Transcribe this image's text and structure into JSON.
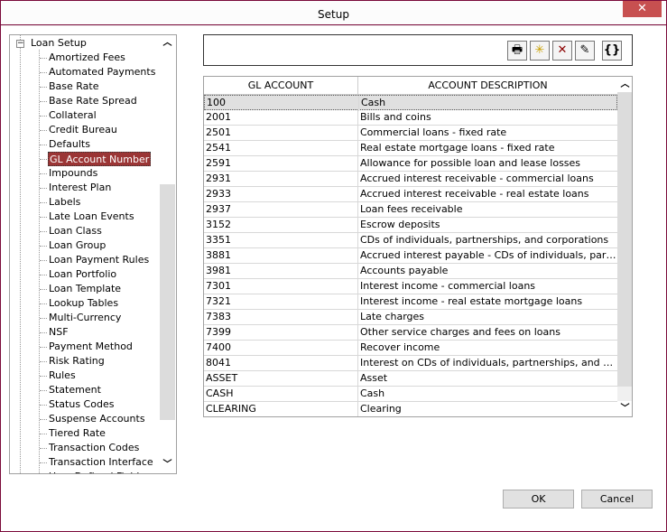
{
  "window": {
    "title": "Setup",
    "close_icon": "close-icon",
    "border_color": "#7a0a3a",
    "selected_color": "#9b3535"
  },
  "tree": {
    "root": "Loan Setup",
    "selected": "GL Account Number",
    "items": [
      "Amortized Fees",
      "Automated Payments",
      "Base Rate",
      "Base Rate Spread",
      "Collateral",
      "Credit Bureau",
      "Defaults",
      "GL Account Number",
      "Impounds",
      "Interest Plan",
      "Labels",
      "Late Loan Events",
      "Loan Class",
      "Loan Group",
      "Loan Payment Rules",
      "Loan Portfolio",
      "Loan Template",
      "Lookup Tables",
      "Multi-Currency",
      "NSF",
      "Payment Method",
      "Risk Rating",
      "Rules",
      "Statement",
      "Status Codes",
      "Suspense Accounts",
      "Tiered Rate",
      "Transaction Codes",
      "Transaction Interface",
      "User Defined Fields"
    ]
  },
  "toolbar": {
    "buttons": [
      "print-icon",
      "new-icon",
      "delete-icon",
      "edit-icon",
      "braces-icon"
    ],
    "braces_label": "{}"
  },
  "grid": {
    "columns": [
      "GL ACCOUNT",
      "ACCOUNT DESCRIPTION"
    ],
    "rows": [
      [
        "100",
        "Cash"
      ],
      [
        "2001",
        "Bills and coins"
      ],
      [
        "2501",
        "Commercial loans - fixed rate"
      ],
      [
        "2541",
        "Real estate mortgage loans - fixed rate"
      ],
      [
        "2591",
        "Allowance for possible loan and lease losses"
      ],
      [
        "2931",
        "Accrued interest receivable - commercial loans"
      ],
      [
        "2933",
        "Accrued interest receivable - real estate loans"
      ],
      [
        "2937",
        "Loan fees receivable"
      ],
      [
        "3152",
        "Escrow deposits"
      ],
      [
        "3351",
        "CDs of individuals, partnerships, and corporations"
      ],
      [
        "3881",
        "Accrued interest payable - CDs of individuals, partnerships, and corporations"
      ],
      [
        "3981",
        "Accounts payable"
      ],
      [
        "7301",
        "Interest income - commercial loans"
      ],
      [
        "7321",
        "Interest income - real estate mortgage loans"
      ],
      [
        "7383",
        "Late charges"
      ],
      [
        "7399",
        "Other service charges and fees on loans"
      ],
      [
        "7400",
        "Recover income"
      ],
      [
        "8041",
        "Interest on CDs of individuals, partnerships, and corporations"
      ],
      [
        "ASSET",
        "Asset"
      ],
      [
        "CASH",
        "Cash"
      ],
      [
        "CLEARING",
        "Clearing"
      ]
    ]
  },
  "buttons": {
    "ok": "OK",
    "cancel": "Cancel"
  }
}
